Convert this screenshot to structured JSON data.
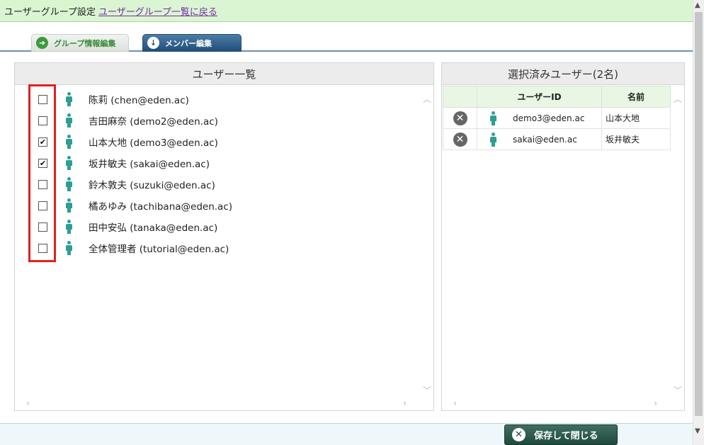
{
  "header": {
    "title": "ユーザーグループ設定",
    "back_link": "ユーザーグループ一覧に戻る"
  },
  "tabs": {
    "group_edit": "グループ情報編集",
    "member_edit": "メンバー編集"
  },
  "user_list": {
    "title": "ユーザー一覧",
    "users": [
      {
        "label": "陈莉 (chen@eden.ac)",
        "checked": false
      },
      {
        "label": "吉田麻奈 (demo2@eden.ac)",
        "checked": false
      },
      {
        "label": "山本大地 (demo3@eden.ac)",
        "checked": true
      },
      {
        "label": "坂井敏夫 (sakai@eden.ac)",
        "checked": true
      },
      {
        "label": "鈴木敦夫 (suzuki@eden.ac)",
        "checked": false
      },
      {
        "label": "橘あゆみ (tachibana@eden.ac)",
        "checked": false
      },
      {
        "label": "田中安弘 (tanaka@eden.ac)",
        "checked": false
      },
      {
        "label": "全体管理者 (tutorial@eden.ac)",
        "checked": false
      }
    ]
  },
  "selected": {
    "title": "選択済みユーザー(2名)",
    "col_userid": "ユーザーID",
    "col_name": "名前",
    "rows": [
      {
        "userid": "demo3@eden.ac",
        "name": "山本大地"
      },
      {
        "userid": "sakai@eden.ac",
        "name": "坂井敏夫"
      }
    ]
  },
  "footer": {
    "save_close": "保存して閉じる"
  },
  "colors": {
    "highlight_box": "#e02020",
    "person_icon": "#2e9e93"
  }
}
